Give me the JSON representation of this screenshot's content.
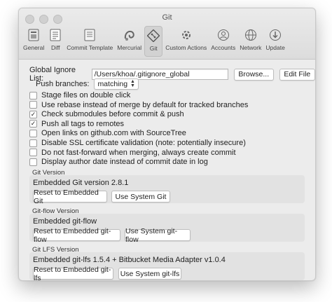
{
  "window": {
    "title": "Git"
  },
  "toolbar": {
    "items": [
      {
        "label": "General",
        "icon": "general-icon"
      },
      {
        "label": "Diff",
        "icon": "diff-icon"
      },
      {
        "label": "Commit Template",
        "icon": "commit-template-icon"
      },
      {
        "label": "Mercurial",
        "icon": "mercurial-icon"
      },
      {
        "label": "Git",
        "icon": "git-icon",
        "active": true
      },
      {
        "label": "Custom Actions",
        "icon": "custom-actions-icon"
      },
      {
        "label": "Accounts",
        "icon": "accounts-icon"
      },
      {
        "label": "Network",
        "icon": "network-icon"
      },
      {
        "label": "Update",
        "icon": "update-icon"
      }
    ]
  },
  "ignore": {
    "label": "Global Ignore List:",
    "path": "/Users/khoa/.gitignore_global",
    "browse_label": "Browse...",
    "edit_label": "Edit File"
  },
  "push": {
    "label": "Push branches:",
    "value": "matching"
  },
  "options": [
    {
      "label": "Stage files on double click",
      "checked": false
    },
    {
      "label": "Use rebase instead of merge by default for tracked branches",
      "checked": false
    },
    {
      "label": "Check submodules before commit & push",
      "checked": true
    },
    {
      "label": "Push all tags to remotes",
      "checked": true
    },
    {
      "label": "Open links on github.com with SourceTree",
      "checked": false
    },
    {
      "label": "Disable SSL certificate validation (note: potentially insecure)",
      "checked": false
    },
    {
      "label": "Do not fast-forward when merging, always create commit",
      "checked": false
    },
    {
      "label": "Display author date instead of commit date in log",
      "checked": false
    }
  ],
  "git_version": {
    "title": "Git Version",
    "text": "Embedded Git version 2.8.1",
    "reset_label": "Reset to Embedded Git",
    "system_label": "Use System Git"
  },
  "gitflow_version": {
    "title": "Git-flow Version",
    "text": "Embedded git-flow",
    "reset_label": "Reset to Embedded git-flow",
    "system_label": "Use System git-flow"
  },
  "gitlfs_version": {
    "title": "Git LFS Version",
    "text": "Embedded git-lfs 1.5.4 + Bitbucket Media Adapter v1.0.4",
    "reset_label": "Reset to Embedded git-lfs",
    "system_label": "Use System git-lfs"
  }
}
